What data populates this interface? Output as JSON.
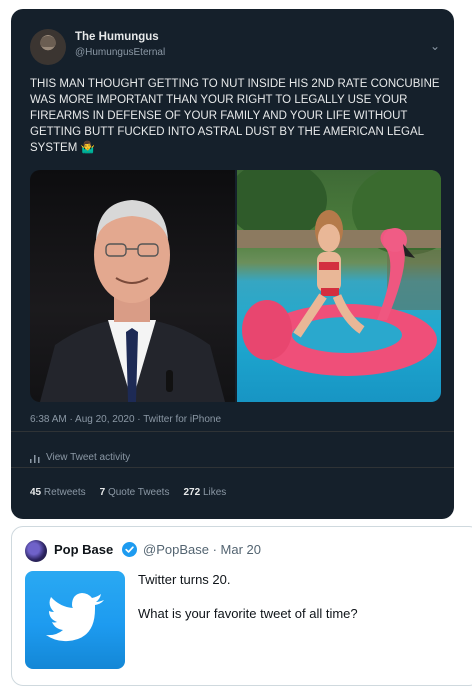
{
  "tweet": {
    "display_name": "The Humungus",
    "handle": "@HumungusEternal",
    "text": "THIS MAN THOUGHT GETTING TO NUT INSIDE HIS 2ND RATE CONCUBINE WAS MORE IMPORTANT THAN YOUR RIGHT TO LEGALLY USE YOUR FIREARMS IN DEFENSE OF YOUR FAMILY AND YOUR LIFE WITHOUT GETTING BUTT FUCKED INTO ASTRAL DUST BY THE AMERICAN LEGAL SYSTEM",
    "emoji": "🤷‍♂️",
    "timestamp": "6:38 AM · Aug 20, 2020 · Twitter for iPhone",
    "activity_label": "View Tweet activity",
    "stats": {
      "retweets_count": "45",
      "retweets_label": "Retweets",
      "quotes_count": "7",
      "quotes_label": "Quote Tweets",
      "likes_count": "272",
      "likes_label": "Likes"
    }
  },
  "quoted": {
    "display_name": "Pop Base",
    "handle_date": "@PopBase · Mar 20",
    "line1": "Twitter turns 20.",
    "line2": "What is your favorite tweet of all time?"
  },
  "colors": {
    "dark_bg": "#15202b",
    "twitter_blue": "#1d9bf0",
    "text_primary": "#e7e9ea",
    "text_secondary": "#8b98a5"
  }
}
